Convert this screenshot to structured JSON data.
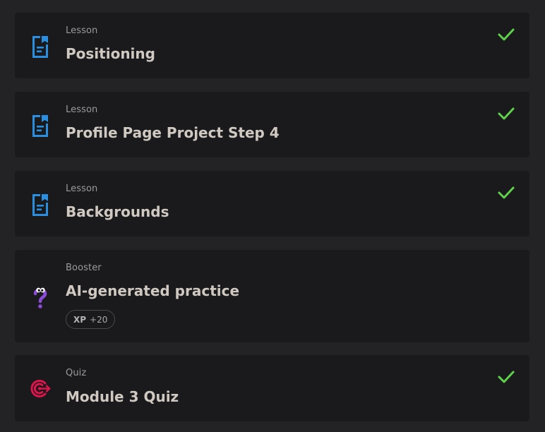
{
  "colors": {
    "page_background": "#232325",
    "card_background": "#1a1a1c",
    "title_text": "#cfc9c2",
    "label_text": "#9b9b9e",
    "lesson_icon": "#2a8fe0",
    "check": "#5fd14b",
    "quiz_icon": "#e0144c",
    "booster_icon": "#8a4bd6"
  },
  "items": [
    {
      "type_label": "Lesson",
      "title": "Positioning",
      "icon": "lesson-document-icon",
      "completed": true
    },
    {
      "type_label": "Lesson",
      "title": "Profile Page Project Step 4",
      "icon": "lesson-document-icon",
      "completed": true
    },
    {
      "type_label": "Lesson",
      "title": "Backgrounds",
      "icon": "lesson-document-icon",
      "completed": true
    },
    {
      "type_label": "Booster",
      "title": "AI-generated practice",
      "icon": "booster-question-mascot-icon",
      "completed": false,
      "xp": {
        "label": "XP",
        "value": "+20"
      }
    },
    {
      "type_label": "Quiz",
      "title": "Module 3 Quiz",
      "icon": "quiz-target-icon",
      "completed": true
    }
  ]
}
